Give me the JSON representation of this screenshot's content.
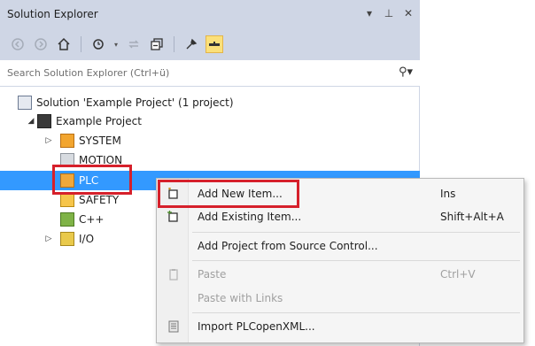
{
  "panel": {
    "title": "Solution Explorer",
    "controls": {
      "dropdown": "▾",
      "pin": "⊥",
      "close": "✕"
    }
  },
  "toolbar": {
    "icons": [
      "back-icon",
      "forward-icon",
      "home-icon",
      "pending-changes-icon",
      "sync-icon",
      "collapse-all-icon",
      "properties-icon",
      "preview-icon"
    ]
  },
  "search": {
    "placeholder": "Search Solution Explorer (Ctrl+ü)",
    "icon_glyph": "⚲▾"
  },
  "tree": {
    "solution": "Solution 'Example Project' (1 project)",
    "project": "Example Project",
    "items": {
      "system": "SYSTEM",
      "motion": "MOTION",
      "plc": "PLC",
      "safety": "SAFETY",
      "cpp": "C++",
      "io": "I/O"
    },
    "arrows": {
      "expanded": "◢",
      "collapsed": "▷"
    }
  },
  "context_menu": {
    "add_new_item": {
      "label": "Add New Item...",
      "shortcut": "Ins"
    },
    "add_existing_item": {
      "label": "Add Existing Item...",
      "shortcut": "Shift+Alt+A"
    },
    "add_from_source_control": {
      "label": "Add Project from Source Control..."
    },
    "paste": {
      "label": "Paste",
      "shortcut": "Ctrl+V"
    },
    "paste_with_links": {
      "label": "Paste with Links"
    },
    "import_plcopenxml": {
      "label": "Import PLCopenXML..."
    }
  },
  "colors": {
    "selection": "#3399ff",
    "highlight_box": "#d6202b",
    "chrome": "#cfd6e5"
  }
}
